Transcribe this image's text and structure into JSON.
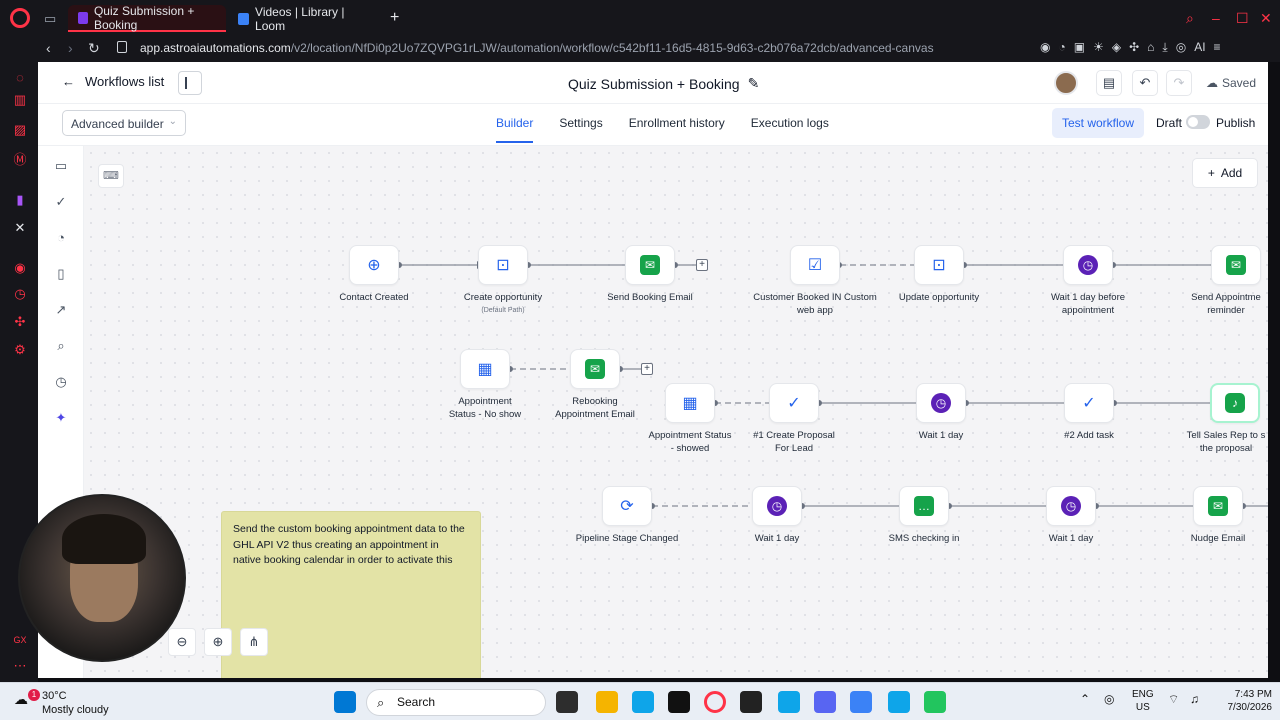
{
  "browser": {
    "tabs": [
      {
        "label": "Quiz Submission + Booking",
        "active": true
      },
      {
        "label": "Videos | Library | Loom",
        "active": false
      }
    ],
    "url_host": "app.astroaiautomations.com",
    "url_path": "/v2/location/NfDi0p2Uo7ZQVPG1rLJW/automation/workflow/c542bf11-16d5-4815-9d63-c2b076a72dcb/advanced-canvas",
    "ai_label": "AI"
  },
  "header": {
    "back_label": "Workflows list",
    "title": "Quiz Submission + Booking",
    "saved_label": "Saved"
  },
  "subheader": {
    "builder_mode": "Advanced builder",
    "tabs": [
      "Builder",
      "Settings",
      "Enrollment history",
      "Execution logs"
    ],
    "test_label": "Test workflow",
    "draft_label": "Draft",
    "publish_label": "Publish"
  },
  "canvas": {
    "add_label": "Add",
    "note_text": "Send the custom booking appointment data to the GHL API V2 thus creating an appointment in native booking calendar in order to activate this",
    "nodes": [
      {
        "id": "contact-created",
        "label": "Contact Created",
        "icon": "user-plus-icon"
      },
      {
        "id": "create-opportunity",
        "label": "Create opportunity",
        "sublabel": "(Default Path)",
        "icon": "opportunity-icon"
      },
      {
        "id": "send-booking-email",
        "label": "Send Booking Email",
        "icon": "email-icon"
      },
      {
        "id": "customer-booked",
        "label": "Customer Booked IN Custom web app",
        "icon": "calendar-check-icon"
      },
      {
        "id": "update-opportunity",
        "label": "Update opportunity",
        "icon": "opportunity-icon"
      },
      {
        "id": "wait-before-appt",
        "label": "Wait 1 day before appointment",
        "icon": "clock-icon"
      },
      {
        "id": "send-appt-reminder",
        "label": "Send Appointme reminder",
        "icon": "email-icon"
      },
      {
        "id": "appt-no-show",
        "label": "Appointment Status - No show",
        "icon": "calendar-icon"
      },
      {
        "id": "rebooking-email",
        "label": "Rebooking Appointment Email",
        "icon": "email-icon"
      },
      {
        "id": "appt-showed",
        "label": "Appointment Status - showed",
        "icon": "calendar-icon"
      },
      {
        "id": "create-proposal",
        "label": "#1 Create Proposal For Lead",
        "icon": "task-check-icon"
      },
      {
        "id": "wait-1-day-a",
        "label": "Wait 1 day",
        "icon": "clock-icon"
      },
      {
        "id": "add-task",
        "label": "#2 Add task",
        "icon": "task-check-icon"
      },
      {
        "id": "tell-sales-rep",
        "label": "Tell Sales Rep to s the proposal",
        "icon": "bell-icon"
      },
      {
        "id": "pipeline-stage",
        "label": "Pipeline Stage Changed",
        "icon": "refresh-icon"
      },
      {
        "id": "wait-1-day-b",
        "label": "Wait 1 day",
        "icon": "clock-icon"
      },
      {
        "id": "sms-checking",
        "label": "SMS checking in",
        "icon": "sms-icon"
      },
      {
        "id": "wait-1-day-c",
        "label": "Wait 1 day",
        "icon": "clock-icon"
      },
      {
        "id": "nudge-email",
        "label": "Nudge Email",
        "icon": "email-icon"
      }
    ]
  },
  "taskbar": {
    "notification_count": "1",
    "temperature": "30°C",
    "condition": "Mostly cloudy",
    "search_label": "Search",
    "lang": "ENG",
    "region": "US",
    "time": "7:43 PM",
    "date": "7/30/2026"
  },
  "colors": {
    "accent": "#2563eb",
    "email_green": "#16a34a",
    "wait_purple": "#5b21b6",
    "note_yellow": "#e3e3a6",
    "opera_red": "#ff3347"
  }
}
